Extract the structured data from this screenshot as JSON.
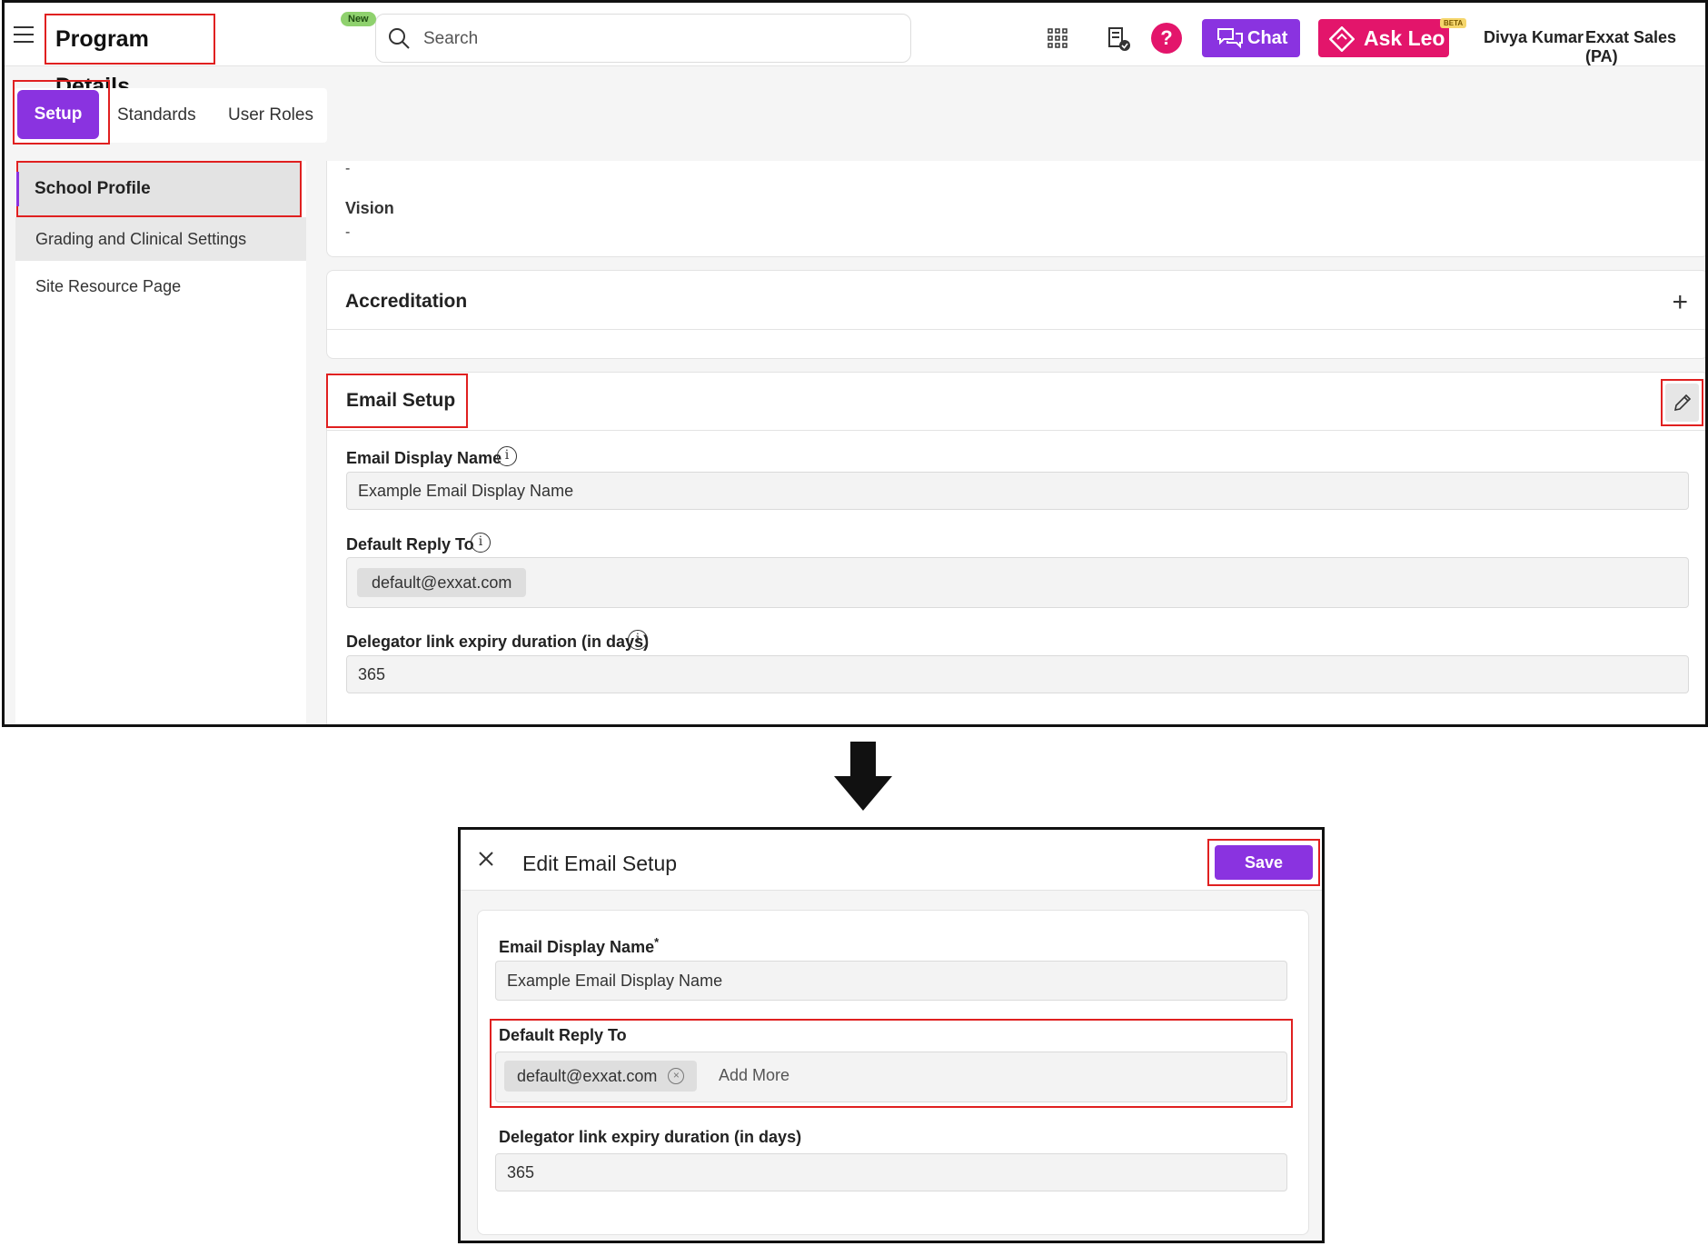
{
  "top": {
    "header": {
      "title": "Program Details",
      "new_badge": "New",
      "search_placeholder": "Search",
      "chat_label": "Chat",
      "ask_leo_label": "Ask Leo",
      "beta_badge": "BETA",
      "help_glyph": "?",
      "user_name": "Divya Kumar",
      "org_name": "Exxat Sales (PA)"
    },
    "tabs": [
      {
        "label": "Setup",
        "active": true
      },
      {
        "label": "Standards",
        "active": false
      },
      {
        "label": "User Roles",
        "active": false
      }
    ],
    "sidebar": {
      "items": [
        {
          "label": "School Profile",
          "active": true
        },
        {
          "label": "Grading and Clinical Settings",
          "active": false
        },
        {
          "label": "Site Resource Page",
          "active": false
        }
      ]
    },
    "profile": {
      "prev_value": "-",
      "vision_label": "Vision",
      "vision_value": "-"
    },
    "accreditation": {
      "title": "Accreditation",
      "expand_icon": "plus-icon"
    },
    "email_setup": {
      "title": "Email Setup",
      "edit_icon": "pencil-icon",
      "display_name_label": "Email Display Name",
      "display_name_value": "Example Email Display Name",
      "reply_to_label": "Default Reply To",
      "reply_to_chip": "default@exxat.com",
      "expiry_label": "Delegator link expiry duration (in days)",
      "expiry_value": "365",
      "info_glyph": "i"
    }
  },
  "modal": {
    "title": "Edit Email Setup",
    "save_label": "Save",
    "display_name_label": "Email Display Name",
    "required_mark": "*",
    "display_name_value": "Example Email Display Name",
    "reply_to_label": "Default Reply To",
    "reply_to_chip": "default@exxat.com",
    "chip_remove_glyph": "×",
    "add_more_label": "Add More",
    "expiry_label": "Delegator link expiry duration (in days)",
    "expiry_value": "365"
  },
  "colors": {
    "accent": "#8a33e0",
    "brand_pink": "#e3156b",
    "highlight": "#e02020"
  }
}
